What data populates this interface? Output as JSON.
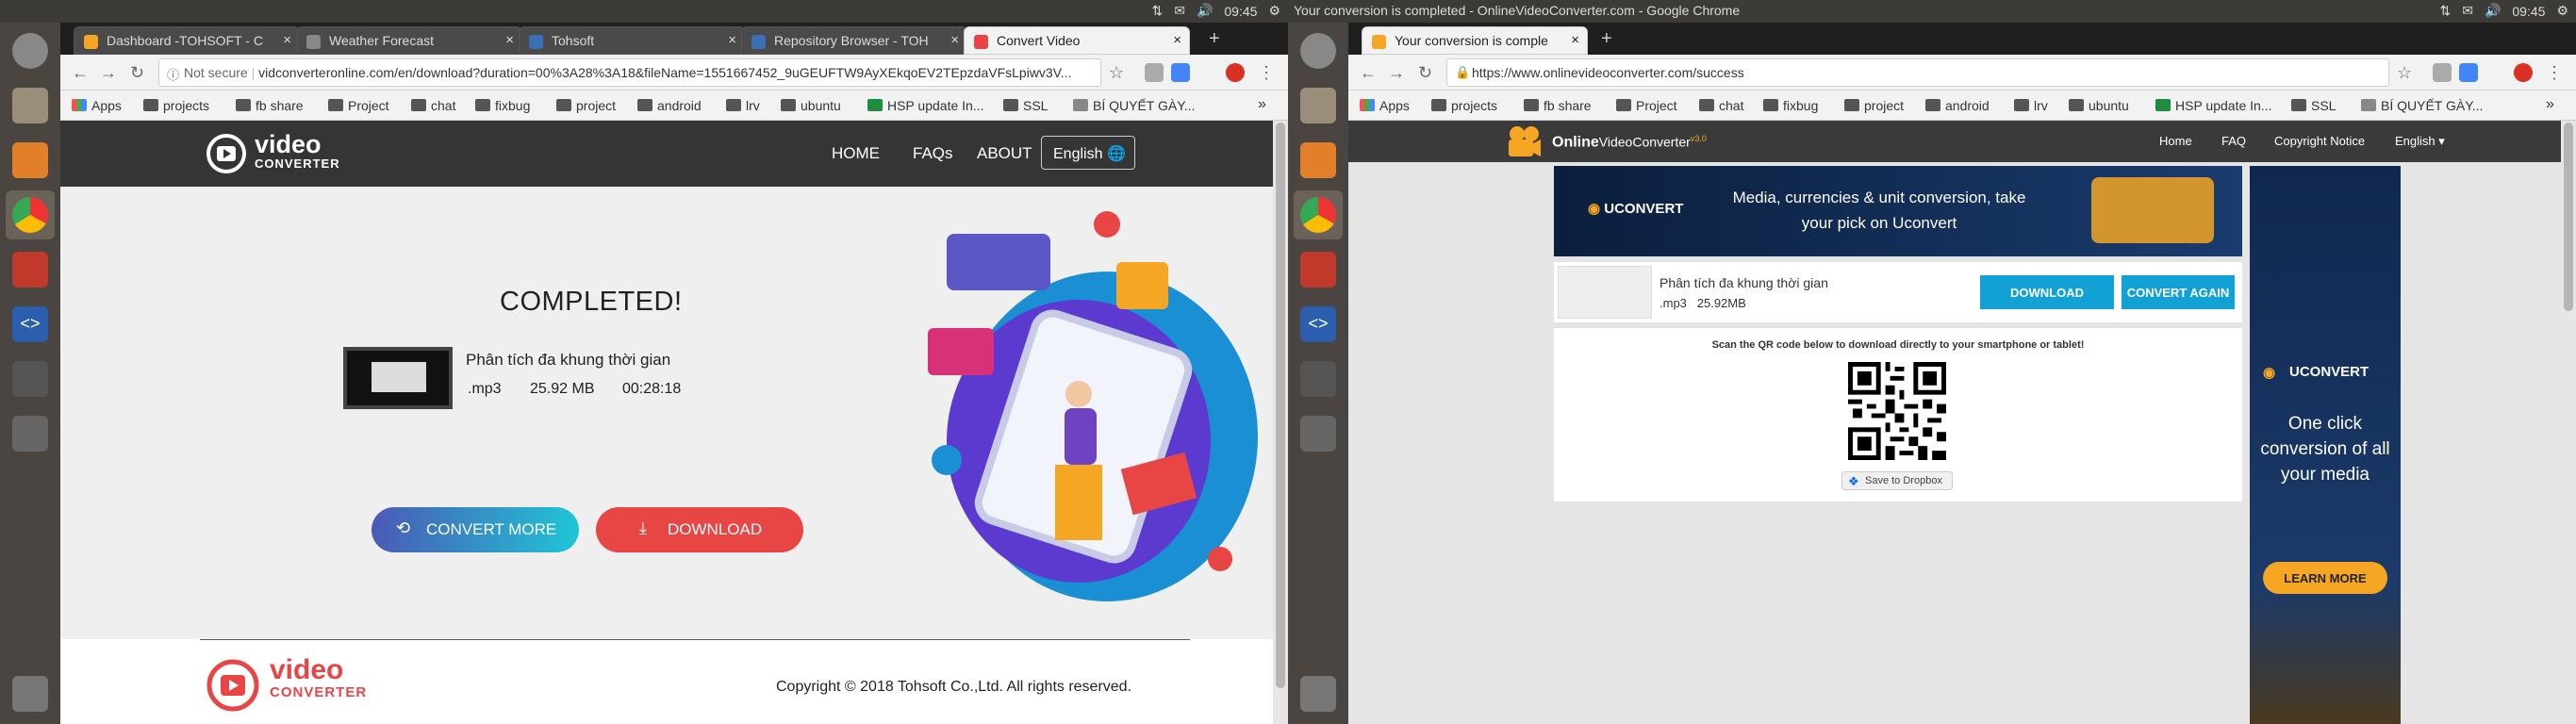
{
  "left": {
    "topbar": {
      "title": "",
      "clock": "09:45"
    },
    "tabs": [
      {
        "label": "Dashboard -TOHSOFT - C",
        "color": "#f5a623"
      },
      {
        "label": "Weather Forecast",
        "color": "#888888"
      },
      {
        "label": "Tohsoft",
        "color": "#3c6fb5"
      },
      {
        "label": "Repository Browser - TOH",
        "color": "#3c6fb5"
      },
      {
        "label": "Convert Video",
        "color": "#e84545"
      }
    ],
    "address": {
      "security": "Not secure",
      "url": "vidconverteronline.com/en/download?duration=00%3A28%3A18&fileName=1551667452_9uGEUFTW9AyXEkqoEV2TEpzdaVFsLpiwv3V..."
    },
    "bookmarks": [
      "Apps",
      "projects",
      "fb share",
      "Project",
      "chat",
      "fixbug",
      "project",
      "android",
      "lrv",
      "ubuntu",
      "HSP update In...",
      "SSL",
      "BÍ QUYẾT GÀY..."
    ],
    "site": {
      "logo_big": "video",
      "logo_small": "CONVERTER",
      "nav": [
        "HOME",
        "FAQs",
        "ABOUT"
      ],
      "lang": "English",
      "completed": "COMPLETED!",
      "file_name": "Phân tích đa khung thời gian",
      "file_ext": ".mp3",
      "file_size": "25.92 MB",
      "duration": "00:28:18",
      "convert_more": "CONVERT MORE",
      "download": "DOWNLOAD",
      "footer_logo_big": "video",
      "footer_logo_small": "CONVERTER",
      "copyright": "Copyright © 2018 Tohsoft Co.,Ltd. All rights reserved."
    }
  },
  "right": {
    "topbar": {
      "title": "Your conversion is completed - OnlineVideoConverter.com - Google Chrome",
      "clock": "09:45"
    },
    "tabs": [
      {
        "label": "Your conversion is comple",
        "color": "#f5a623"
      }
    ],
    "address": {
      "url": "https://www.onlinevideoconverter.com/success"
    },
    "bookmarks": [
      "Apps",
      "projects",
      "fb share",
      "Project",
      "chat",
      "fixbug",
      "project",
      "android",
      "lrv",
      "ubuntu",
      "HSP update In...",
      "SSL",
      "BÍ QUYẾT GÀY..."
    ],
    "site": {
      "logo_online": "Online",
      "logo_rest": "VideoConverter",
      "version": "v3.0",
      "nav": [
        "Home",
        "FAQ",
        "Copyright Notice",
        "English ▾"
      ],
      "ad_brand": "UCONVERT",
      "ad_text": "Media, currencies & unit conversion, take your pick on Uconvert",
      "file_name": "Phân tích đa khung thời gian",
      "file_ext": ".mp3",
      "file_size": "25.92MB",
      "download": "DOWNLOAD",
      "convert_again": "CONVERT AGAIN",
      "qr_label": "Scan the QR code below to download directly to your smartphone or tablet!",
      "dropbox": "Save to Dropbox",
      "side_brand": "UCONVERT",
      "side_text": "One click conversion of all your media",
      "learn_more": "LEARN MORE"
    }
  }
}
